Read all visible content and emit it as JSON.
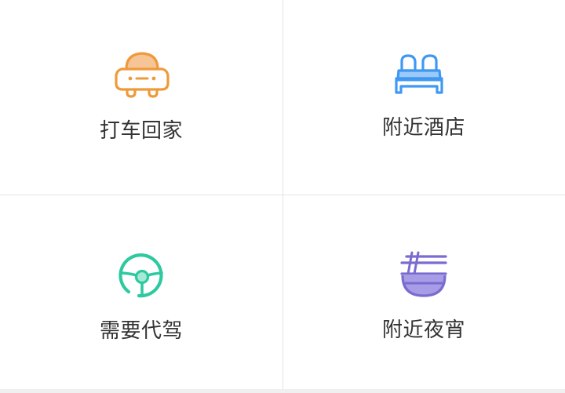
{
  "tiles": [
    {
      "id": "taxi-home",
      "label": "打车回家",
      "icon": "car-icon",
      "color": "#ef9a3a"
    },
    {
      "id": "nearby-hotel",
      "label": "附近酒店",
      "icon": "bed-icon",
      "color": "#3f99f2"
    },
    {
      "id": "designated-driver",
      "label": "需要代驾",
      "icon": "steering-wheel-icon",
      "color": "#2ec9a0"
    },
    {
      "id": "late-night-snack",
      "label": "附近夜宵",
      "icon": "noodle-bowl-icon",
      "color": "#7a6bd0"
    }
  ]
}
